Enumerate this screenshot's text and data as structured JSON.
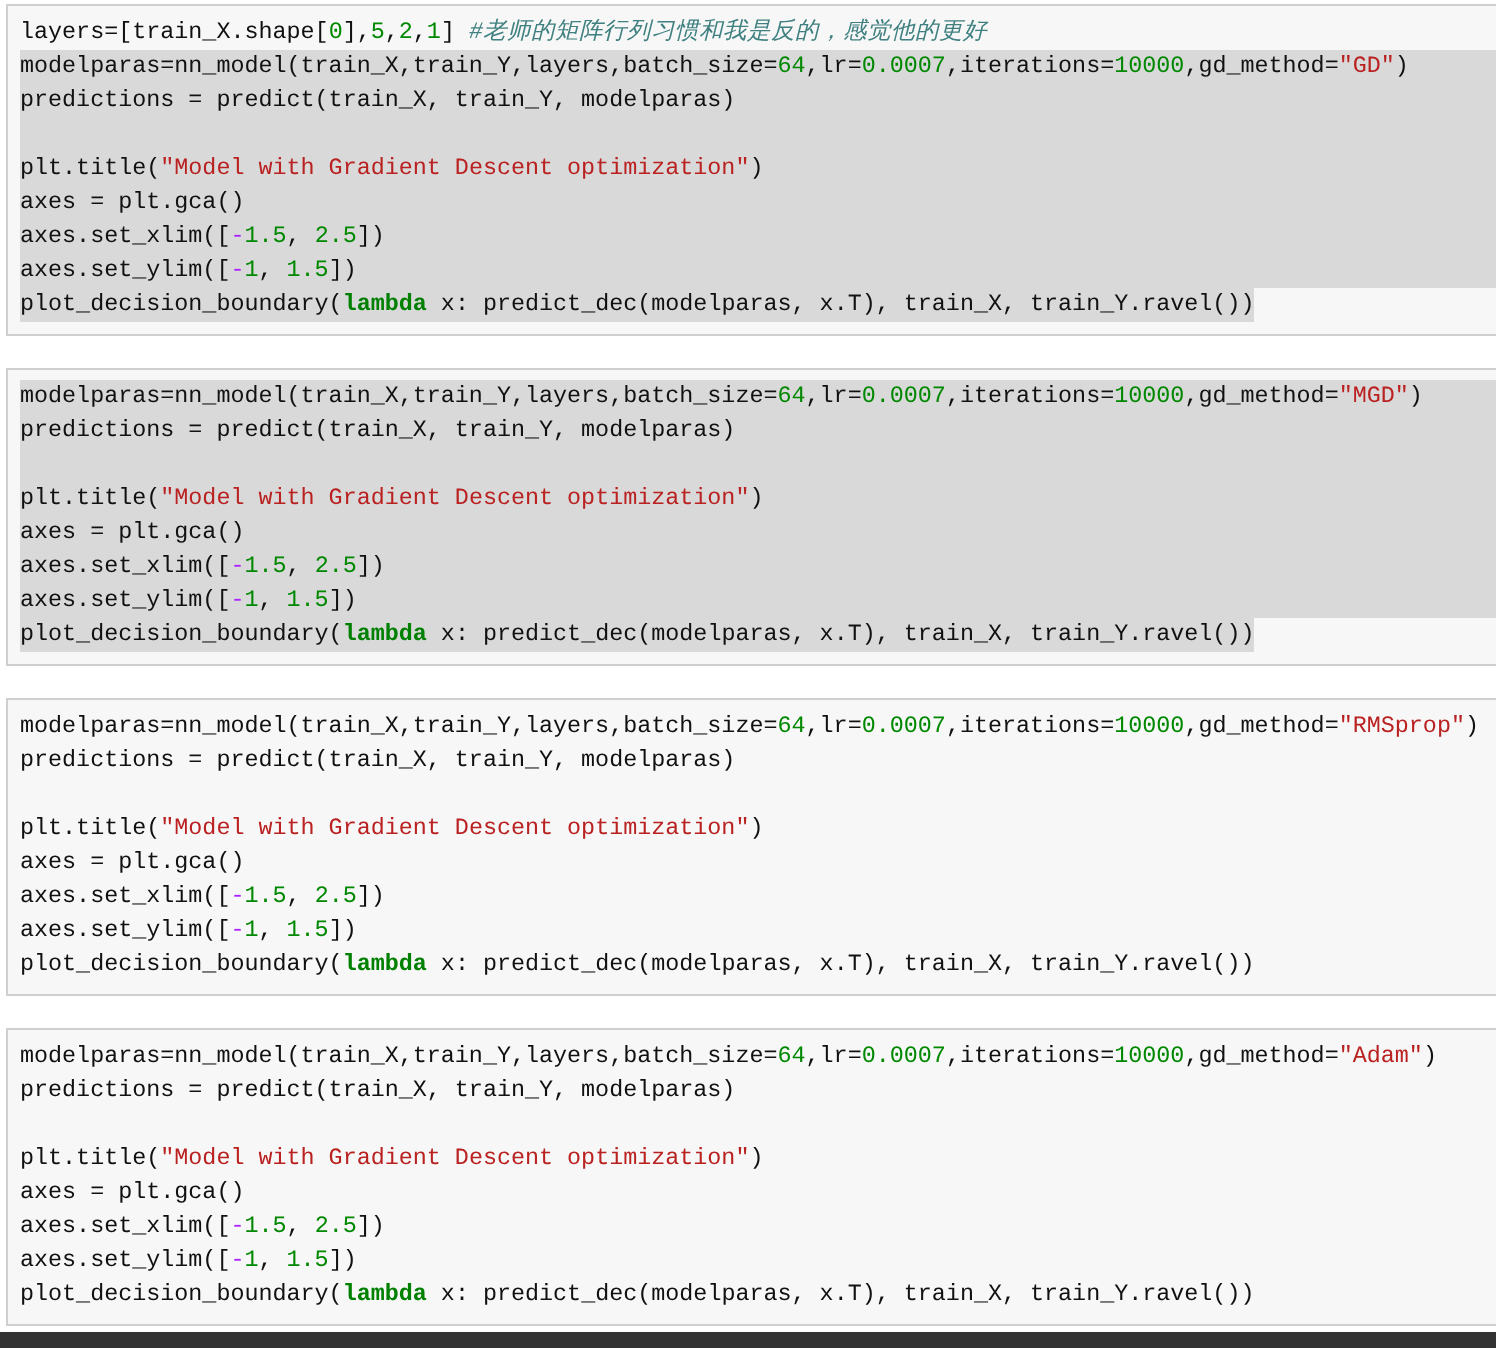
{
  "cells": [
    {
      "lines": [
        {
          "selected": false,
          "tokens": [
            {
              "kind": "plain",
              "text": "layers=[train_X.shape["
            },
            {
              "kind": "number",
              "text": "0"
            },
            {
              "kind": "plain",
              "text": "],"
            },
            {
              "kind": "number",
              "text": "5"
            },
            {
              "kind": "plain",
              "text": ","
            },
            {
              "kind": "number",
              "text": "2"
            },
            {
              "kind": "plain",
              "text": ","
            },
            {
              "kind": "number",
              "text": "1"
            },
            {
              "kind": "plain",
              "text": "] "
            },
            {
              "kind": "comment",
              "text": "#老师的矩阵行列习惯和我是反的，感觉他的更好"
            }
          ]
        },
        {
          "selected": true,
          "tokens": [
            {
              "kind": "plain",
              "text": "modelparas=nn_model(train_X,train_Y,layers,batch_size="
            },
            {
              "kind": "number",
              "text": "64"
            },
            {
              "kind": "plain",
              "text": ",lr="
            },
            {
              "kind": "number",
              "text": "0.0007"
            },
            {
              "kind": "plain",
              "text": ",iterations="
            },
            {
              "kind": "number",
              "text": "10000"
            },
            {
              "kind": "plain",
              "text": ",gd_method="
            },
            {
              "kind": "string",
              "text": "\"GD\""
            },
            {
              "kind": "plain",
              "text": ")"
            }
          ]
        },
        {
          "selected": true,
          "tokens": [
            {
              "kind": "plain",
              "text": "predictions = predict(train_X, train_Y, modelparas)"
            }
          ]
        },
        {
          "selected": true
        },
        {
          "selected": true,
          "tokens": [
            {
              "kind": "plain",
              "text": "plt.title("
            },
            {
              "kind": "string",
              "text": "\"Model with Gradient Descent optimization\""
            },
            {
              "kind": "plain",
              "text": ")"
            }
          ]
        },
        {
          "selected": true,
          "tokens": [
            {
              "kind": "plain",
              "text": "axes = plt.gca()"
            }
          ]
        },
        {
          "selected": true,
          "tokens": [
            {
              "kind": "plain",
              "text": "axes.set_xlim(["
            },
            {
              "kind": "operator",
              "text": "-"
            },
            {
              "kind": "number",
              "text": "1.5"
            },
            {
              "kind": "plain",
              "text": ", "
            },
            {
              "kind": "number",
              "text": "2.5"
            },
            {
              "kind": "plain",
              "text": "])"
            }
          ]
        },
        {
          "selected": true,
          "tokens": [
            {
              "kind": "plain",
              "text": "axes.set_ylim(["
            },
            {
              "kind": "operator",
              "text": "-"
            },
            {
              "kind": "number",
              "text": "1"
            },
            {
              "kind": "plain",
              "text": ", "
            },
            {
              "kind": "number",
              "text": "1.5"
            },
            {
              "kind": "plain",
              "text": "])"
            }
          ]
        },
        {
          "selected": true,
          "tokens": [
            {
              "kind": "plain",
              "text": "plot_decision_boundary("
            },
            {
              "kind": "keyword",
              "text": "lambda"
            },
            {
              "kind": "plain",
              "text": " x: predict_dec(modelparas, x.T), train_X, train_Y.ravel())"
            }
          ]
        }
      ]
    },
    {
      "lines": [
        {
          "selected": true,
          "tokens": [
            {
              "kind": "plain",
              "text": "modelparas=nn_model(train_X,train_Y,layers,batch_size="
            },
            {
              "kind": "number",
              "text": "64"
            },
            {
              "kind": "plain",
              "text": ",lr="
            },
            {
              "kind": "number",
              "text": "0.0007"
            },
            {
              "kind": "plain",
              "text": ",iterations="
            },
            {
              "kind": "number",
              "text": "10000"
            },
            {
              "kind": "plain",
              "text": ",gd_method="
            },
            {
              "kind": "string",
              "text": "\"MGD\""
            },
            {
              "kind": "plain",
              "text": ")"
            }
          ]
        },
        {
          "selected": true,
          "tokens": [
            {
              "kind": "plain",
              "text": "predictions = predict(train_X, train_Y, modelparas)"
            }
          ]
        },
        {
          "selected": true
        },
        {
          "selected": true,
          "tokens": [
            {
              "kind": "plain",
              "text": "plt.title("
            },
            {
              "kind": "string",
              "text": "\"Model with Gradient Descent optimization\""
            },
            {
              "kind": "plain",
              "text": ")"
            }
          ]
        },
        {
          "selected": true,
          "tokens": [
            {
              "kind": "plain",
              "text": "axes = plt.gca()"
            }
          ]
        },
        {
          "selected": true,
          "tokens": [
            {
              "kind": "plain",
              "text": "axes.set_xlim(["
            },
            {
              "kind": "operator",
              "text": "-"
            },
            {
              "kind": "number",
              "text": "1.5"
            },
            {
              "kind": "plain",
              "text": ", "
            },
            {
              "kind": "number",
              "text": "2.5"
            },
            {
              "kind": "plain",
              "text": "])"
            }
          ]
        },
        {
          "selected": true,
          "tokens": [
            {
              "kind": "plain",
              "text": "axes.set_ylim(["
            },
            {
              "kind": "operator",
              "text": "-"
            },
            {
              "kind": "number",
              "text": "1"
            },
            {
              "kind": "plain",
              "text": ", "
            },
            {
              "kind": "number",
              "text": "1.5"
            },
            {
              "kind": "plain",
              "text": "])"
            }
          ]
        },
        {
          "selected": true,
          "tokens": [
            {
              "kind": "plain",
              "text": "plot_decision_boundary("
            },
            {
              "kind": "keyword",
              "text": "lambda"
            },
            {
              "kind": "plain",
              "text": " x: predict_dec(modelparas, x.T), train_X, train_Y.ravel())"
            }
          ]
        }
      ]
    },
    {
      "lines": [
        {
          "selected": false,
          "tokens": [
            {
              "kind": "plain",
              "text": "modelparas=nn_model(train_X,train_Y,layers,batch_size="
            },
            {
              "kind": "number",
              "text": "64"
            },
            {
              "kind": "plain",
              "text": ",lr="
            },
            {
              "kind": "number",
              "text": "0.0007"
            },
            {
              "kind": "plain",
              "text": ",iterations="
            },
            {
              "kind": "number",
              "text": "10000"
            },
            {
              "kind": "plain",
              "text": ",gd_method="
            },
            {
              "kind": "string",
              "text": "\"RMSprop\""
            },
            {
              "kind": "plain",
              "text": ")"
            }
          ]
        },
        {
          "selected": false,
          "tokens": [
            {
              "kind": "plain",
              "text": "predictions = predict(train_X, train_Y, modelparas)"
            }
          ]
        },
        {
          "selected": false
        },
        {
          "selected": false,
          "tokens": [
            {
              "kind": "plain",
              "text": "plt.title("
            },
            {
              "kind": "string",
              "text": "\"Model with Gradient Descent optimization\""
            },
            {
              "kind": "plain",
              "text": ")"
            }
          ]
        },
        {
          "selected": false,
          "tokens": [
            {
              "kind": "plain",
              "text": "axes = plt.gca()"
            }
          ]
        },
        {
          "selected": false,
          "tokens": [
            {
              "kind": "plain",
              "text": "axes.set_xlim(["
            },
            {
              "kind": "operator",
              "text": "-"
            },
            {
              "kind": "number",
              "text": "1.5"
            },
            {
              "kind": "plain",
              "text": ", "
            },
            {
              "kind": "number",
              "text": "2.5"
            },
            {
              "kind": "plain",
              "text": "])"
            }
          ]
        },
        {
          "selected": false,
          "tokens": [
            {
              "kind": "plain",
              "text": "axes.set_ylim(["
            },
            {
              "kind": "operator",
              "text": "-"
            },
            {
              "kind": "number",
              "text": "1"
            },
            {
              "kind": "plain",
              "text": ", "
            },
            {
              "kind": "number",
              "text": "1.5"
            },
            {
              "kind": "plain",
              "text": "])"
            }
          ]
        },
        {
          "selected": false,
          "tokens": [
            {
              "kind": "plain",
              "text": "plot_decision_boundary("
            },
            {
              "kind": "keyword",
              "text": "lambda"
            },
            {
              "kind": "plain",
              "text": " x: predict_dec(modelparas, x.T), train_X, train_Y.ravel())"
            }
          ]
        }
      ]
    },
    {
      "lines": [
        {
          "selected": false,
          "tokens": [
            {
              "kind": "plain",
              "text": "modelparas=nn_model(train_X,train_Y,layers,batch_size="
            },
            {
              "kind": "number",
              "text": "64"
            },
            {
              "kind": "plain",
              "text": ",lr="
            },
            {
              "kind": "number",
              "text": "0.0007"
            },
            {
              "kind": "plain",
              "text": ",iterations="
            },
            {
              "kind": "number",
              "text": "10000"
            },
            {
              "kind": "plain",
              "text": ",gd_method="
            },
            {
              "kind": "string",
              "text": "\"Adam\""
            },
            {
              "kind": "plain",
              "text": ")"
            }
          ]
        },
        {
          "selected": false,
          "tokens": [
            {
              "kind": "plain",
              "text": "predictions = predict(train_X, train_Y, modelparas)"
            }
          ]
        },
        {
          "selected": false
        },
        {
          "selected": false,
          "tokens": [
            {
              "kind": "plain",
              "text": "plt.title("
            },
            {
              "kind": "string",
              "text": "\"Model with Gradient Descent optimization\""
            },
            {
              "kind": "plain",
              "text": ")"
            }
          ]
        },
        {
          "selected": false,
          "tokens": [
            {
              "kind": "plain",
              "text": "axes = plt.gca()"
            }
          ]
        },
        {
          "selected": false,
          "tokens": [
            {
              "kind": "plain",
              "text": "axes.set_xlim(["
            },
            {
              "kind": "operator",
              "text": "-"
            },
            {
              "kind": "number",
              "text": "1.5"
            },
            {
              "kind": "plain",
              "text": ", "
            },
            {
              "kind": "number",
              "text": "2.5"
            },
            {
              "kind": "plain",
              "text": "])"
            }
          ]
        },
        {
          "selected": false,
          "tokens": [
            {
              "kind": "plain",
              "text": "axes.set_ylim(["
            },
            {
              "kind": "operator",
              "text": "-"
            },
            {
              "kind": "number",
              "text": "1"
            },
            {
              "kind": "plain",
              "text": ", "
            },
            {
              "kind": "number",
              "text": "1.5"
            },
            {
              "kind": "plain",
              "text": "])"
            }
          ]
        },
        {
          "selected": false,
          "tokens": [
            {
              "kind": "plain",
              "text": "plot_decision_boundary("
            },
            {
              "kind": "keyword",
              "text": "lambda"
            },
            {
              "kind": "plain",
              "text": " x: predict_dec(modelparas, x.T), train_X, train_Y.ravel())"
            }
          ]
        }
      ]
    }
  ]
}
